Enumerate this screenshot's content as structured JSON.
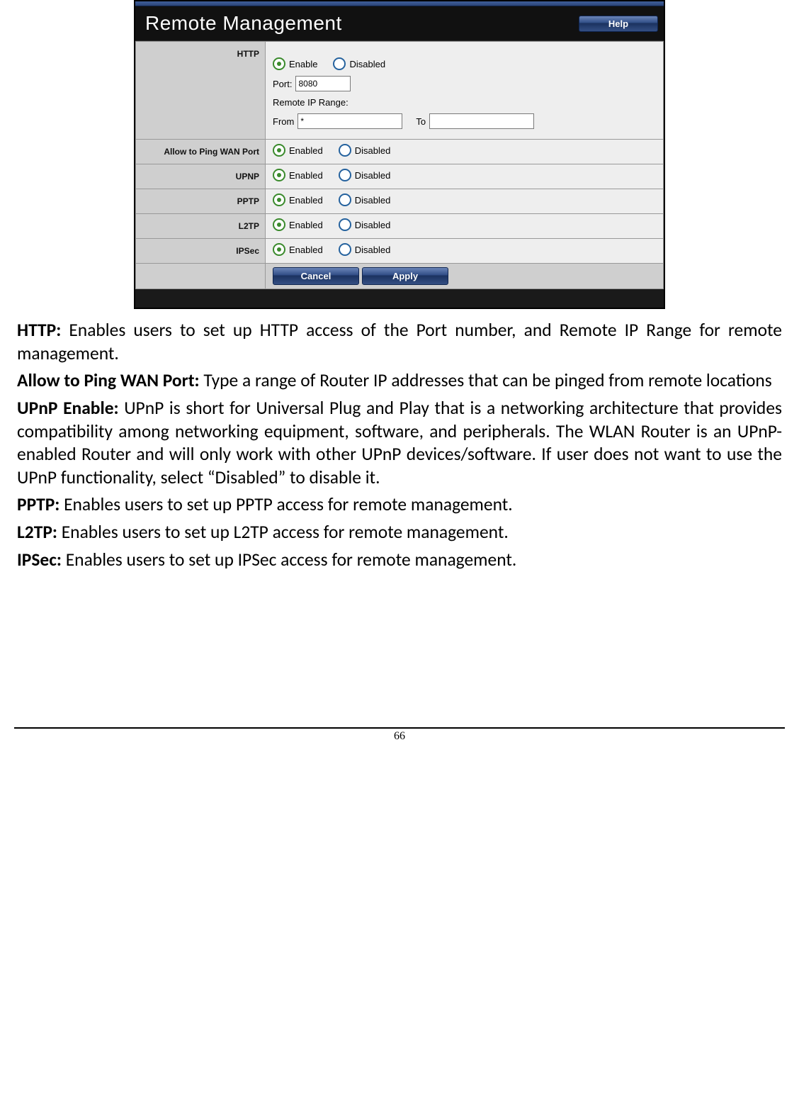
{
  "panel": {
    "title": "Remote Management",
    "help_label": "Help",
    "labels": {
      "enable": "Enable",
      "enabled": "Enabled",
      "disabled": "Disabled",
      "port": "Port:",
      "remote_ip_range": "Remote IP Range:",
      "from": "From",
      "to": "To",
      "cancel": "Cancel",
      "apply": "Apply"
    },
    "rows": {
      "http": {
        "label": "HTTP",
        "port_value": "8080",
        "from_value": "*",
        "to_value": ""
      },
      "ping": {
        "label": "Allow to Ping WAN Port"
      },
      "upnp": {
        "label": "UPNP"
      },
      "pptp": {
        "label": "PPTP"
      },
      "l2tp": {
        "label": "L2TP"
      },
      "ipsec": {
        "label": "IPSec"
      }
    }
  },
  "doc": {
    "http_b": "HTTP:",
    "http_t": " Enables users to set up HTTP access of the Port number, and Remote IP Range for remote management.",
    "ping_b": "Allow to Ping WAN Port:",
    "ping_t": " Type a range of Router IP addresses that can be pinged from remote locations",
    "upnp_b": "UPnP Enable:",
    "upnp_t": " UPnP is short for Universal Plug and Play that is a networking architecture that provides compatibility among networking equipment, software, and peripherals. The WLAN Router is an UPnP-enabled Router and will only work with other UPnP devices/software. If user does not want to use the UPnP functionality, select “Disabled” to disable it.",
    "pptp_b": "PPTP:",
    "pptp_t": " Enables users to set up PPTP access for remote management.",
    "l2tp_b": "L2TP:",
    "l2tp_t": " Enables users to set up L2TP access for remote management.",
    "ipsec_b": "IPSec:",
    "ipsec_t": " Enables users to set up IPSec access for remote management."
  },
  "page_number": "66"
}
